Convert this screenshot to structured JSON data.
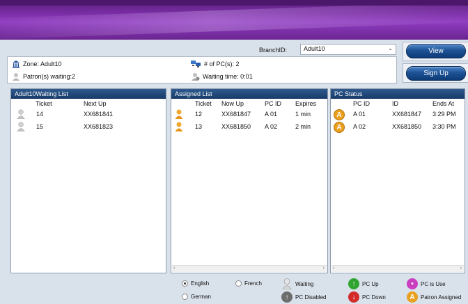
{
  "header": {
    "branch_label": "BranchID:",
    "branch_value": "Adult10",
    "view_label": "View",
    "signup_label": "Sign Up"
  },
  "info": {
    "zone": "Zone: Adult10",
    "patrons_waiting": "Patron(s) waiting:2",
    "num_pcs": "# of PC(s): 2",
    "waiting_time": "Waiting time: 0:01"
  },
  "waiting_list": {
    "title": "Adult10Waiting List",
    "columns": [
      "Ticket",
      "Next Up"
    ],
    "rows": [
      {
        "ticket": "14",
        "next_up": "XX681841"
      },
      {
        "ticket": "15",
        "next_up": "XX681823"
      }
    ]
  },
  "assigned_list": {
    "title": "Assigned List",
    "columns": [
      "Ticket",
      "Now Up",
      "PC ID",
      "Expires"
    ],
    "rows": [
      {
        "ticket": "12",
        "now_up": "XX681847",
        "pc_id": "A 01",
        "expires": "1 min"
      },
      {
        "ticket": "13",
        "now_up": "XX681850",
        "pc_id": "A 02",
        "expires": "2 min"
      }
    ]
  },
  "pc_status": {
    "title": "PC Status",
    "columns": [
      "PC ID",
      "ID",
      "Ends At"
    ],
    "rows": [
      {
        "pc_id": "A 01",
        "id": "XX681847",
        "ends_at": "3:29 PM"
      },
      {
        "pc_id": "A 02",
        "id": "XX681850",
        "ends_at": "3:30 PM"
      }
    ]
  },
  "languages": {
    "english": "English",
    "french": "French",
    "german": "German",
    "selected": "English"
  },
  "legend": {
    "waiting": "Waiting",
    "pc_disabled": "PC Disabled",
    "pc_up": "PC Up",
    "pc_down": "PC Down",
    "pc_in_use": "PC is Use",
    "patron_assigned": "Patron Assigned"
  },
  "colors": {
    "banner": "#7b2ea6",
    "panel_header": "#163a68",
    "button": "#1d5296",
    "assigned_badge": "#e8a01e",
    "pc_up": "#2fa52f",
    "pc_down": "#d42a2a",
    "pc_in_use": "#c93fbf"
  }
}
